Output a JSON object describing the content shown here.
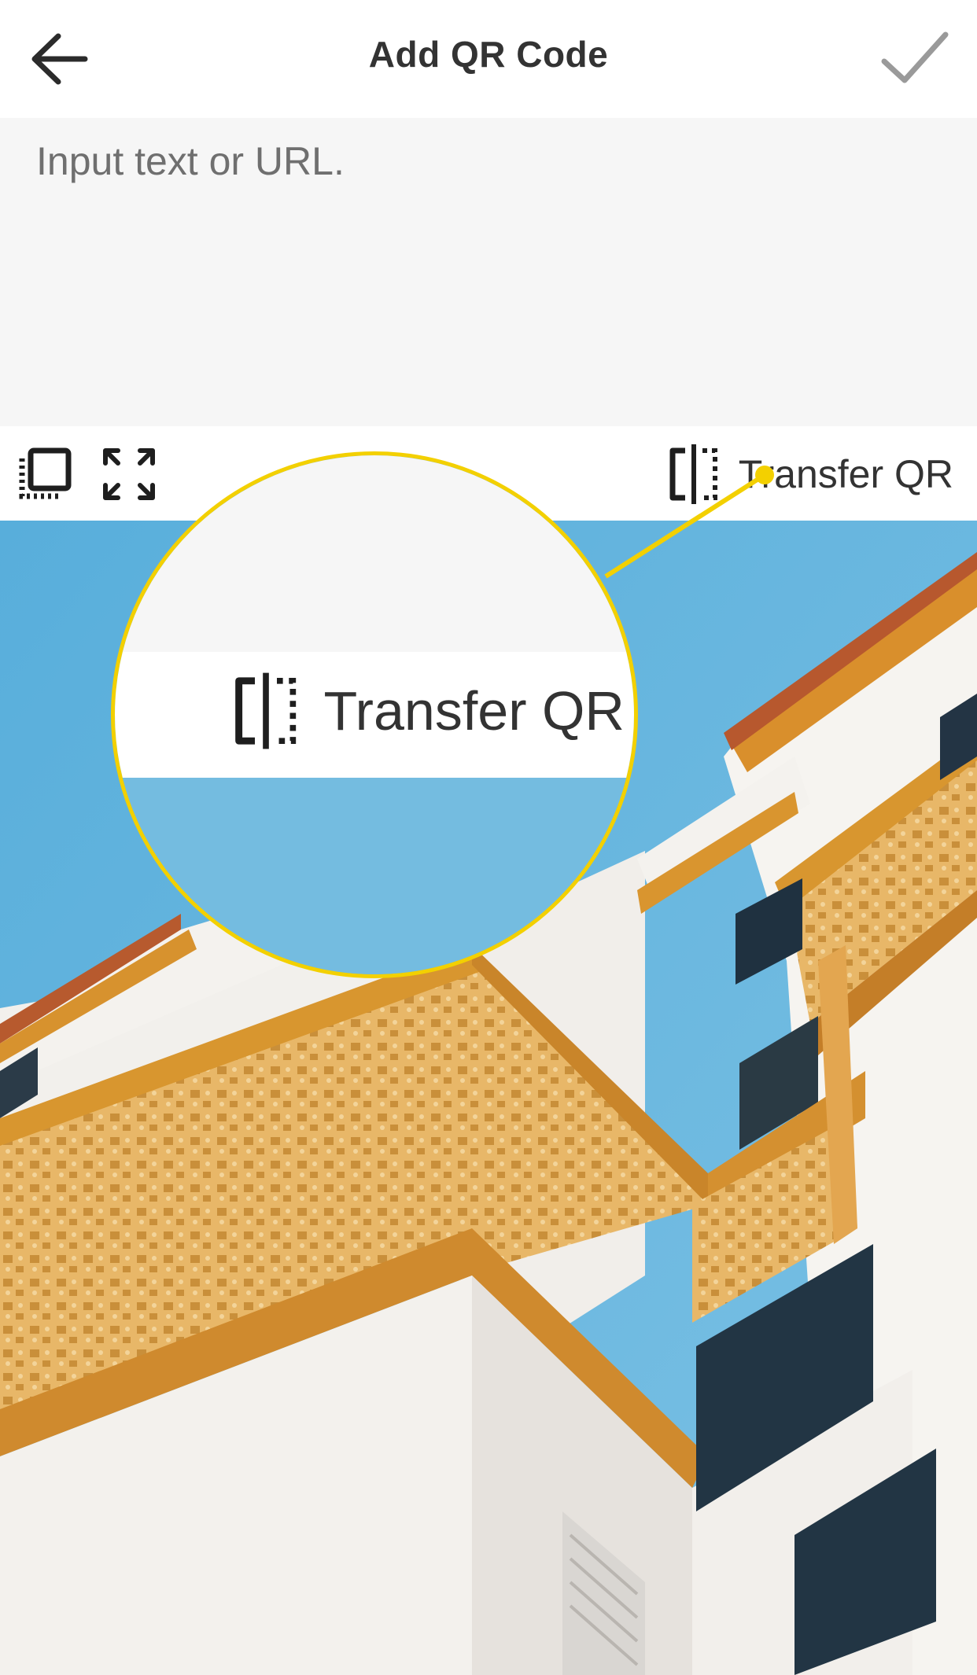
{
  "header": {
    "title": "Add QR Code",
    "back_icon": "arrow-left-icon",
    "confirm_icon": "checkmark-icon"
  },
  "input": {
    "placeholder": "Input text or URL.",
    "value": ""
  },
  "toolbar": {
    "left_tools": [
      {
        "name": "layers-select-tool",
        "icon": "layer-frame-icon"
      },
      {
        "name": "expand-tool",
        "icon": "expand-arrows-icon"
      }
    ],
    "transfer": {
      "label": "Transfer QR",
      "icon": "split-frame-icon"
    }
  },
  "callout": {
    "label": "Transfer QR",
    "accent_color": "#f3d000"
  },
  "colors": {
    "sky": "#5fb2df",
    "wall": "#f4f2ee",
    "trim": "#d8962f",
    "text": "#333333",
    "input_bg": "#f6f6f6"
  }
}
